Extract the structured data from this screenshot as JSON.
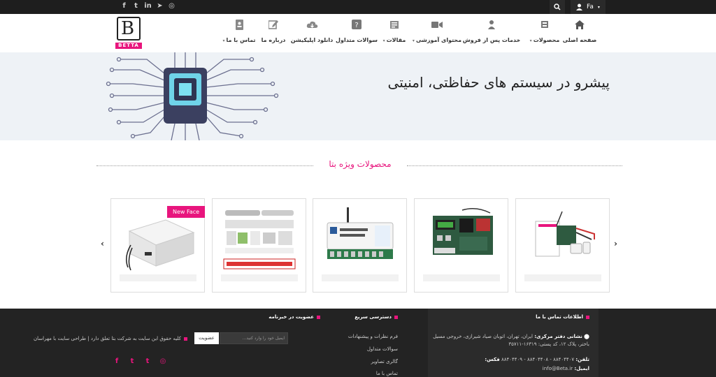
{
  "topbar": {
    "social_icons": [
      "instagram-icon",
      "telegram-icon",
      "linkedin-icon",
      "twitter-icon",
      "facebook-icon"
    ],
    "language": "Fa"
  },
  "brand": {
    "logo_letter": "B",
    "logo_name": "BETTA"
  },
  "nav": [
    {
      "label": "صفحه اصلی",
      "icon": "home-icon"
    },
    {
      "label": "محصولات",
      "icon": "products-icon",
      "caret": true
    },
    {
      "label": "خدمات پس از فروش",
      "icon": "support-icon"
    },
    {
      "label": "محتوای آموزشی",
      "icon": "video-icon",
      "caret": true
    },
    {
      "label": "مقالات",
      "icon": "articles-icon",
      "caret": true
    },
    {
      "label": "سوالات متداول",
      "icon": "faq-icon"
    },
    {
      "label": "دانلود اپلیکیشن",
      "icon": "cloud-download-icon"
    },
    {
      "label": "درباره ما",
      "icon": "edit-icon"
    },
    {
      "label": "تماس با ما",
      "icon": "contact-book-icon",
      "caret": true
    }
  ],
  "hero": {
    "title": "پیشرو در سیستم های حفاظتی، امنیتی"
  },
  "products": {
    "title": "محصولات ویژه بتا",
    "ribbon": "New Face",
    "cards": [
      "product-1",
      "product-2",
      "product-3",
      "product-4",
      "product-5"
    ]
  },
  "footer": {
    "contact": {
      "title": "اطلاعات تماس با ما",
      "address_label": "نشانی دفتر مرکزی:",
      "address": "ایران، تهران، اتوبان صیاد شیرازی، خروجی مسیل باختر، پلاک ۱۲، کد پستی: ۱۶۳۱۹-۳۵۷۱۱",
      "phone_label": "تلفن:",
      "phone": "۸۸۴۰۴۴۰۷ - ۸۸۴۰۴۴۰۸ - ۸۸۴۰۴۴۰۹",
      "fax_label": "فکس:",
      "email_label": "ایمیل:",
      "email": "info@Beta.ir"
    },
    "quick": {
      "title": "دسترسی سریع",
      "links": [
        "فرم نظرات و پیشنهادات",
        "سوالات متداول",
        "گالری تصاویر",
        "تماس با ما"
      ]
    },
    "newsletter": {
      "title": "عضویت در خبرنامه",
      "placeholder": "ایمیل خود را وارد کنید...",
      "button": "عضویت"
    },
    "copyright": "کلیه حقوق این سایت به شرکت بتا تعلق دارد | طراحی سایت با مهراسان",
    "social_icons": [
      "instagram-icon",
      "twitter-icon",
      "twitter-icon",
      "facebook-icon"
    ]
  },
  "colors": {
    "accent": "#e8157d",
    "dark": "#232323"
  }
}
